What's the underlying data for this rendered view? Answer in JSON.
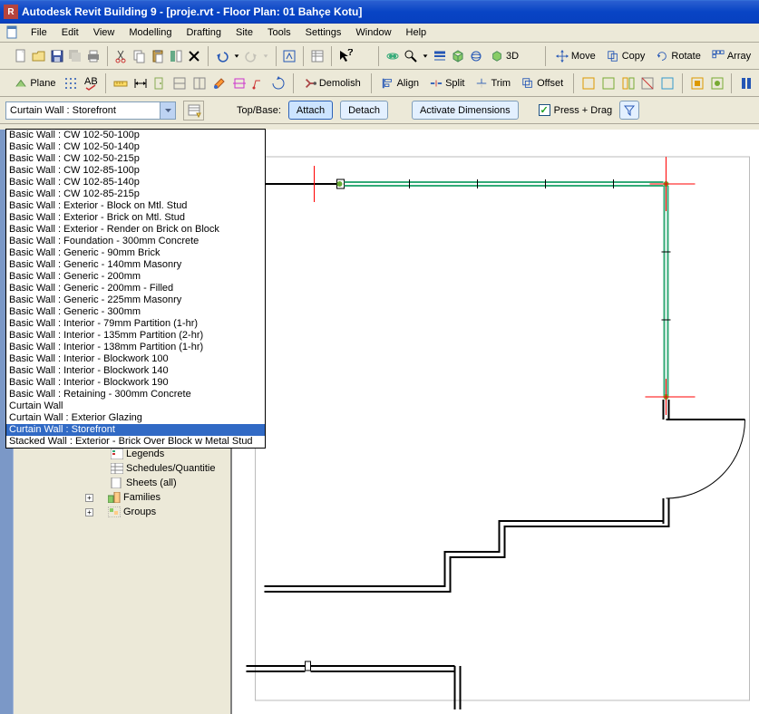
{
  "title": "Autodesk Revit Building 9 - [proje.rvt - Floor Plan: 01 Bahçe Kotu]",
  "menus": [
    "File",
    "Edit",
    "View",
    "Modelling",
    "Drafting",
    "Site",
    "Tools",
    "Settings",
    "Window",
    "Help"
  ],
  "toolbar1_std": [
    "new",
    "open",
    "save",
    "save-all",
    "print",
    "sep",
    "cut",
    "copy",
    "paste",
    "match",
    "delete",
    "sep",
    "undo",
    "undo-drop",
    "redo",
    "redo-drop",
    "sep",
    "dynamic-mod",
    "sep",
    "props",
    "sep",
    "help-cursor"
  ],
  "toolbar1_view": [
    "cam",
    "zoom",
    "zoom-drop",
    "thin",
    "3d-box",
    "orbit",
    "3d-label"
  ],
  "toolbar1_edit": [
    {
      "icon": "move",
      "label": "Move"
    },
    {
      "icon": "copy",
      "label": "Copy"
    },
    {
      "icon": "rotate",
      "label": "Rotate"
    },
    {
      "icon": "array",
      "label": "Array"
    }
  ],
  "toolbar2_left": [
    {
      "icon": "plane",
      "label": "Plane"
    },
    {
      "icon": "grid-dots",
      "label": ""
    },
    {
      "icon": "spell",
      "label": ""
    }
  ],
  "toolbar2_mid_icons": [
    "tape",
    "dim",
    "door-tag",
    "win-tag-a",
    "win-tag-b",
    "paint",
    "clip",
    "spot",
    "revision"
  ],
  "toolbar2_demolish": {
    "label": "Demolish"
  },
  "toolbar2_modify": [
    {
      "icon": "align",
      "label": "Align"
    },
    {
      "icon": "split",
      "label": "Split"
    },
    {
      "icon": "trim",
      "label": "Trim"
    },
    {
      "icon": "offset",
      "label": "Offset"
    }
  ],
  "toolbar2_right_icons": [
    "cg1",
    "cg2",
    "cg3",
    "cg4",
    "cg5",
    "sep",
    "cg6",
    "cg7",
    "sep",
    "cg8"
  ],
  "type_selector_value": "Curtain Wall : Storefront",
  "opt_topbase": "Top/Base:",
  "opt_attach": "Attach",
  "opt_detach": "Detach",
  "opt_activate": "Activate Dimensions",
  "opt_pressdrag": "Press + Drag",
  "dropdown_items": [
    "Basic Wall : CW 102-50-100p",
    "Basic Wall : CW 102-50-140p",
    "Basic Wall : CW 102-50-215p",
    "Basic Wall : CW 102-85-100p",
    "Basic Wall : CW 102-85-140p",
    "Basic Wall : CW 102-85-215p",
    "Basic Wall : Exterior - Block on Mtl. Stud",
    "Basic Wall : Exterior - Brick on Mtl. Stud",
    "Basic Wall : Exterior - Render on Brick on Block",
    "Basic Wall : Foundation - 300mm Concrete",
    "Basic Wall : Generic - 90mm Brick",
    "Basic Wall : Generic - 140mm Masonry",
    "Basic Wall : Generic - 200mm",
    "Basic Wall : Generic - 200mm - Filled",
    "Basic Wall : Generic - 225mm Masonry",
    "Basic Wall : Generic - 300mm",
    "Basic Wall : Interior - 79mm Partition (1-hr)",
    "Basic Wall : Interior - 135mm Partition (2-hr)",
    "Basic Wall : Interior - 138mm Partition (1-hr)",
    "Basic Wall : Interior - Blockwork 100",
    "Basic Wall : Interior - Blockwork 140",
    "Basic Wall : Interior - Blockwork 190",
    "Basic Wall : Retaining - 300mm Concrete",
    "Curtain Wall",
    "Curtain Wall : Exterior Glazing",
    "Curtain Wall : Storefront",
    "Stacked Wall : Exterior - Brick Over Block w Metal Stud"
  ],
  "dropdown_highlighted_index": 25,
  "tree": {
    "legends": "Legends",
    "schedules": "Schedules/Quantitie",
    "sheets": "Sheets (all)",
    "families": "Families",
    "groups": "Groups"
  }
}
